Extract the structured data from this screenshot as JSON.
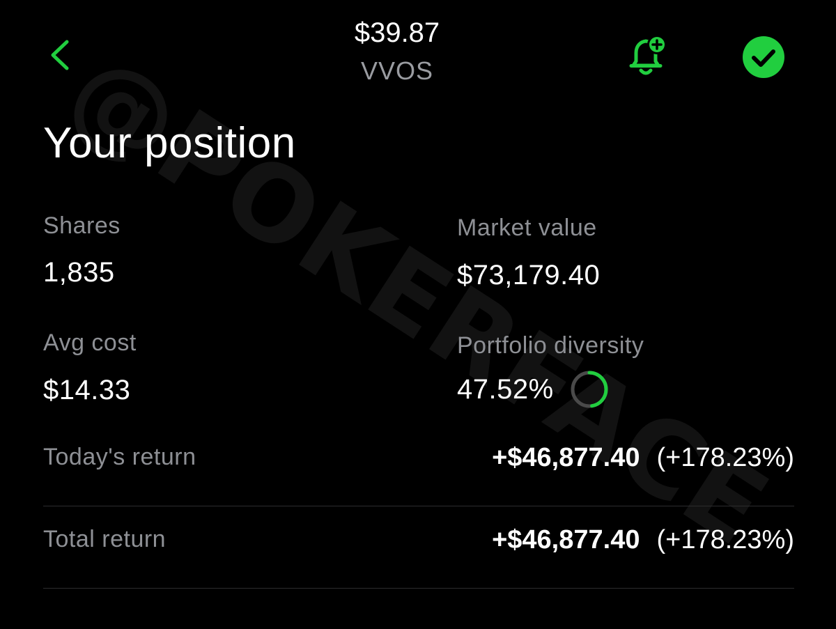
{
  "theme": {
    "accent": "#21ce3f",
    "background": "#000000",
    "text_primary": "#ffffff",
    "text_secondary": "#8e9095",
    "divider": "#2c2c2e",
    "ring_track": "#4a4a4a"
  },
  "watermark": {
    "text": "@POKERFACE"
  },
  "header": {
    "back_icon": "chevron-left-icon",
    "price": "$39.87",
    "symbol": "VVOS",
    "alert_icon": "bell-plus-icon",
    "watchlist_icon": "check-circle-icon"
  },
  "position": {
    "title": "Your position",
    "shares": {
      "label": "Shares",
      "value": "1,835"
    },
    "market_value": {
      "label": "Market value",
      "value": "$73,179.40"
    },
    "avg_cost": {
      "label": "Avg cost",
      "value": "$14.33"
    },
    "portfolio_diversity": {
      "label": "Portfolio diversity",
      "value": "47.52%",
      "fraction": 0.4752
    },
    "todays_return": {
      "label": "Today's return",
      "amount": "+$46,877.40",
      "percent": "(+178.23%)"
    },
    "total_return": {
      "label": "Total return",
      "amount": "+$46,877.40",
      "percent": "(+178.23%)"
    }
  }
}
